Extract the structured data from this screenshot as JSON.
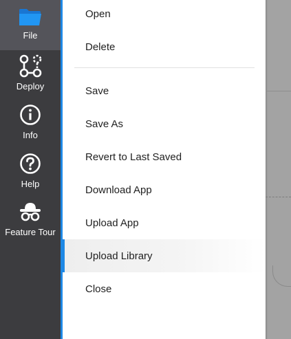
{
  "sidebar": {
    "items": [
      {
        "id": "file",
        "label": "File",
        "icon": "folder-icon",
        "active": true
      },
      {
        "id": "deploy",
        "label": "Deploy",
        "icon": "deploy-nodes-icon",
        "active": false
      },
      {
        "id": "info",
        "label": "Info",
        "icon": "info-icon",
        "active": false
      },
      {
        "id": "help",
        "label": "Help",
        "icon": "help-icon",
        "active": false
      },
      {
        "id": "feature-tour",
        "label": "Feature Tour",
        "icon": "spy-hat-glasses-icon",
        "active": false
      }
    ]
  },
  "menu": {
    "items": [
      {
        "label": "Open"
      },
      {
        "label": "Delete"
      },
      {
        "label": "Save"
      },
      {
        "label": "Save As"
      },
      {
        "label": "Revert to Last Saved"
      },
      {
        "label": "Download App"
      },
      {
        "label": "Upload App"
      },
      {
        "label": "Upload Library",
        "hovered": true
      },
      {
        "label": "Close"
      }
    ]
  },
  "colors": {
    "sidebar_bg": "#3c3c3f",
    "sidebar_active_bg": "#54545a",
    "accent": "#1e88e5",
    "menu_bg": "#ffffff",
    "menu_text": "#1f1f1f",
    "canvas_bg": "#a3a3a3"
  }
}
